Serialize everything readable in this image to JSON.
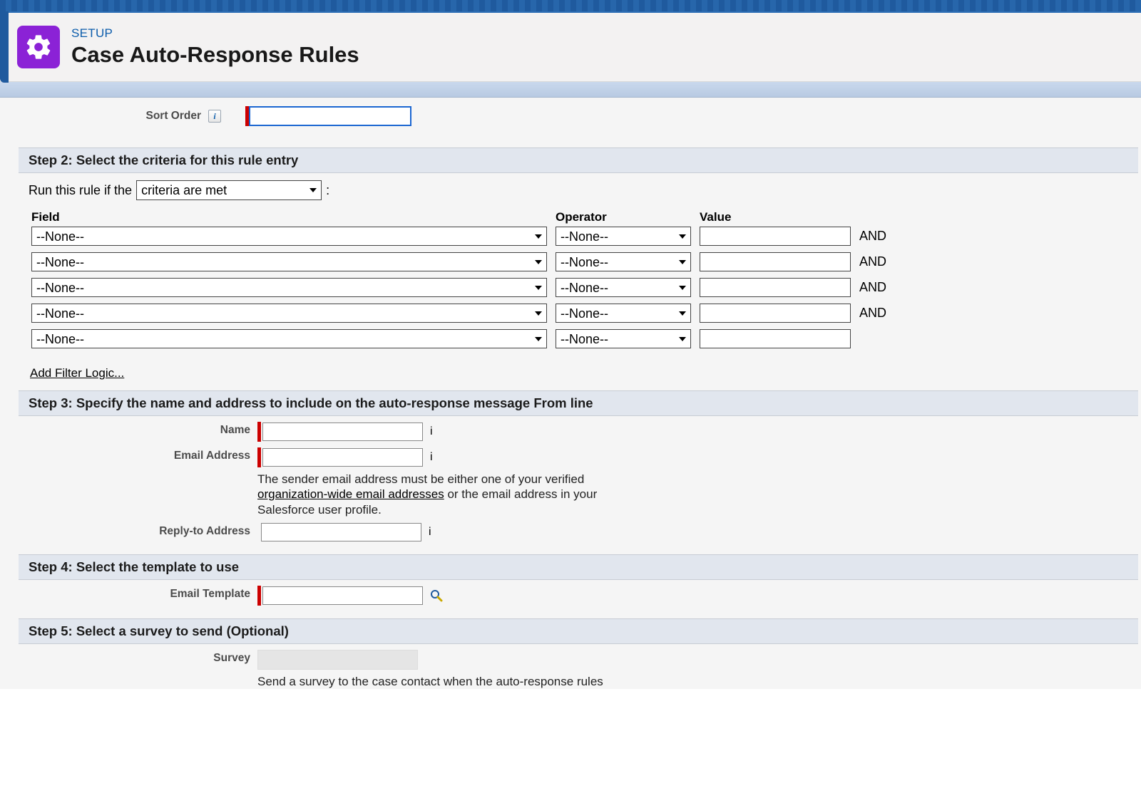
{
  "header": {
    "breadcrumb": "SETUP",
    "title": "Case Auto-Response Rules"
  },
  "step1": {
    "sort_order_label": "Sort Order",
    "sort_order_value": ""
  },
  "step2": {
    "title": "Step 2: Select the criteria for this rule entry",
    "run_prefix": "Run this rule if the",
    "criteria_selected": "criteria are met",
    "colon": ":",
    "headers": {
      "field": "Field",
      "operator": "Operator",
      "value": "Value"
    },
    "rows": [
      {
        "field": "--None--",
        "operator": "--None--",
        "value": "",
        "and": "AND"
      },
      {
        "field": "--None--",
        "operator": "--None--",
        "value": "",
        "and": "AND"
      },
      {
        "field": "--None--",
        "operator": "--None--",
        "value": "",
        "and": "AND"
      },
      {
        "field": "--None--",
        "operator": "--None--",
        "value": "",
        "and": "AND"
      },
      {
        "field": "--None--",
        "operator": "--None--",
        "value": "",
        "and": ""
      }
    ],
    "add_filter_logic": "Add Filter Logic..."
  },
  "step3": {
    "title": "Step 3: Specify the name and address to include on the auto-response message From line",
    "name_label": "Name",
    "email_label": "Email Address",
    "reply_to_label": "Reply-to Address",
    "hint_prefix": "The sender email address must be either one of your verified ",
    "hint_link": "organization-wide email addresses",
    "hint_suffix": " or the email address in your Salesforce user profile."
  },
  "step4": {
    "title": "Step 4: Select the template to use",
    "template_label": "Email Template"
  },
  "step5": {
    "title": "Step 5: Select a survey to send (Optional)",
    "survey_label": "Survey",
    "hint": "Send a survey to the case contact when the auto-response rules"
  }
}
